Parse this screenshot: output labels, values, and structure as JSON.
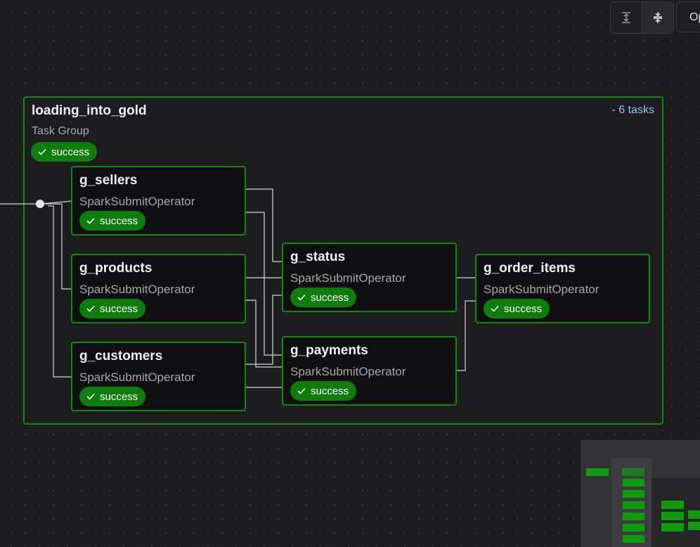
{
  "toolbar": {
    "expand_icon": "expand-vertical-icon",
    "collapse_icon": "collapse-vertical-icon",
    "open_label": "Op"
  },
  "task_group": {
    "name": "loading_into_gold",
    "type_label": "Task Group",
    "status": "success",
    "task_count_label": "- 6 tasks"
  },
  "tasks": [
    {
      "name": "g_sellers",
      "operator": "SparkSubmitOperator",
      "status": "success"
    },
    {
      "name": "g_products",
      "operator": "SparkSubmitOperator",
      "status": "success"
    },
    {
      "name": "g_customers",
      "operator": "SparkSubmitOperator",
      "status": "success"
    },
    {
      "name": "g_status",
      "operator": "SparkSubmitOperator",
      "status": "success"
    },
    {
      "name": "g_payments",
      "operator": "SparkSubmitOperator",
      "status": "success"
    },
    {
      "name": "g_order_items",
      "operator": "SparkSubmitOperator",
      "status": "success"
    }
  ],
  "colors": {
    "success": "#0e7d0e",
    "node_border": "#128a12",
    "canvas": "#1c1c1f",
    "task_count": "#8fc4ff"
  }
}
